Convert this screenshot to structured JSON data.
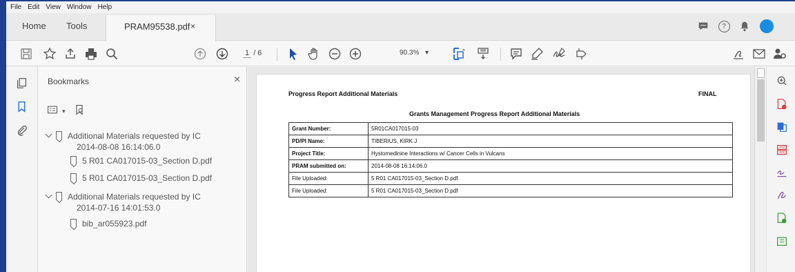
{
  "menu": [
    "File",
    "Edit",
    "View",
    "Window",
    "Help"
  ],
  "tabs": {
    "home": "Home",
    "tools": "Tools",
    "document": "PRAM95538.pdf",
    "close": "×"
  },
  "toolbar": {
    "page_current": "1",
    "page_total": "/ 6",
    "zoom": "90.3%"
  },
  "bookmarks": {
    "title": "Bookmarks",
    "close": "×",
    "items": [
      {
        "label": "Additional Materials requested by IC",
        "date": "2014-08-08 16:14:06.0"
      },
      {
        "label": "5 R01 CA017015-03_Section D.pdf"
      },
      {
        "label": "5 R01 CA017015-03_Section D.pdf"
      },
      {
        "label": "Additional Materials requested by IC",
        "date": "2014-07-16 14:01:53.0"
      },
      {
        "label": "bib_ar055923.pdf"
      }
    ]
  },
  "document": {
    "title": "Progress Report Additional Materials",
    "status": "FINAL",
    "heading": "Grants Management Progress Report Additional Materials",
    "rows": [
      {
        "label": "Grant Number:",
        "value": "5R01CA017015-03"
      },
      {
        "label": "PD/PI Name:",
        "value": "TIBERIUS, KIRK J"
      },
      {
        "label": "Project Title:",
        "value": "Hystomedinine Interactions w/ Cancer Cells in Vulcans"
      },
      {
        "label": "PRAM submitted on:",
        "value": "2014-08-08 16:14:06.0"
      },
      {
        "label": "File Uploaded:",
        "value": "5 R01 CA017015-03_Section D.pdf"
      },
      {
        "label": "File Uploaded:",
        "value": "5 R01 CA017015-03_Section D.pdf"
      }
    ]
  },
  "colors": {
    "accent": "#1a8de0",
    "window_border": "#1f3f8f",
    "tool_red": "#d93a3a",
    "tool_blue": "#2b6fd6",
    "tool_green": "#3a9a3a",
    "tool_purple": "#7b4fb0"
  }
}
